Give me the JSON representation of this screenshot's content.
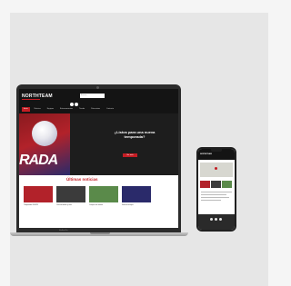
{
  "laptop": {
    "brand": "MacBook Pro",
    "site": {
      "logo": "NORTHTEAM",
      "search_placeholder": "Buscar...",
      "nav": [
        "Inicio",
        "Noticias",
        "Equipos",
        "Entrenamientos",
        "Tienda",
        "Patrocinios",
        "Contacto"
      ],
      "hero": {
        "image_word": "RADA",
        "heading": "¿Listos para una nueva temporada?",
        "cta": "Ver más"
      },
      "news_title": "Últimas noticias",
      "news": [
        {
          "caption": "Temporada 2024/25",
          "thumb": "#b2222a"
        },
        {
          "caption": "Club del balón y mas",
          "thumb": "#3b3b3b"
        },
        {
          "caption": "Campus de verano",
          "thumb": "#5a8a4a"
        },
        {
          "caption": "Nuevos fichajes",
          "thumb": "#2a2a6a"
        }
      ]
    }
  },
  "phone": {
    "logo": "NORTHTEAM",
    "thumbs": [
      "#b2222a",
      "#3b3b3b",
      "#5a8a4a"
    ]
  },
  "colors": {
    "brand": "#c41d24",
    "dark": "#141414"
  }
}
